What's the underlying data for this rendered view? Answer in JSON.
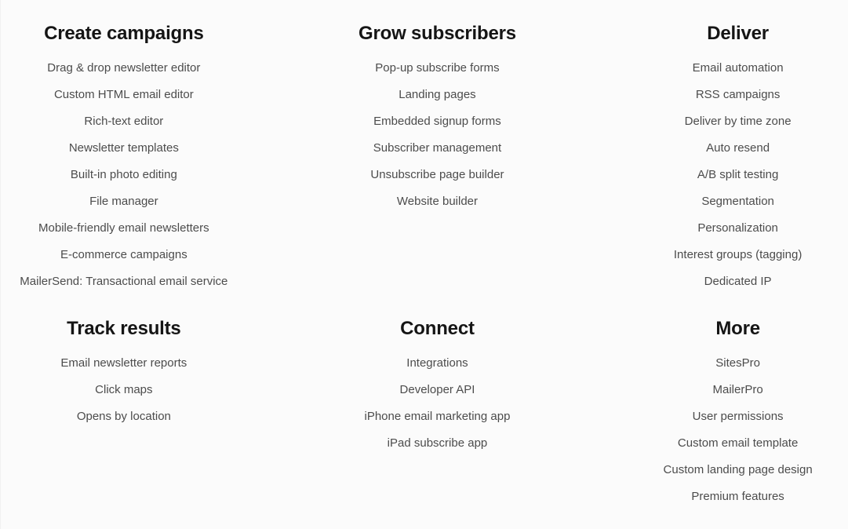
{
  "page": {
    "background_color": "#fbfbfb",
    "heading_color": "#151515",
    "link_color": "#4c4c4c"
  },
  "sections": [
    {
      "id": "create-campaigns",
      "title": "Create campaigns",
      "items": [
        "Drag & drop newsletter editor",
        "Custom HTML email editor",
        "Rich-text editor",
        "Newsletter templates",
        "Built-in photo editing",
        "File manager",
        "Mobile-friendly email newsletters",
        "E-commerce campaigns",
        "MailerSend: Transactional email service"
      ]
    },
    {
      "id": "grow-subscribers",
      "title": "Grow subscribers",
      "items": [
        "Pop-up subscribe forms",
        "Landing pages",
        "Embedded signup forms",
        "Subscriber management",
        "Unsubscribe page builder",
        "Website builder"
      ]
    },
    {
      "id": "deliver",
      "title": "Deliver",
      "items": [
        "Email automation",
        "RSS campaigns",
        "Deliver by time zone",
        "Auto resend",
        "A/B split testing",
        "Segmentation",
        "Personalization",
        "Interest groups (tagging)",
        "Dedicated IP"
      ]
    },
    {
      "id": "track-results",
      "title": "Track results",
      "items": [
        "Email newsletter reports",
        "Click maps",
        "Opens by location"
      ]
    },
    {
      "id": "connect",
      "title": "Connect",
      "items": [
        "Integrations",
        "Developer API",
        "iPhone email marketing app",
        "iPad subscribe app"
      ]
    },
    {
      "id": "more",
      "title": "More",
      "items": [
        "SitesPro",
        "MailerPro",
        "User permissions",
        "Custom email template",
        "Custom landing page design",
        "Premium features"
      ]
    }
  ]
}
